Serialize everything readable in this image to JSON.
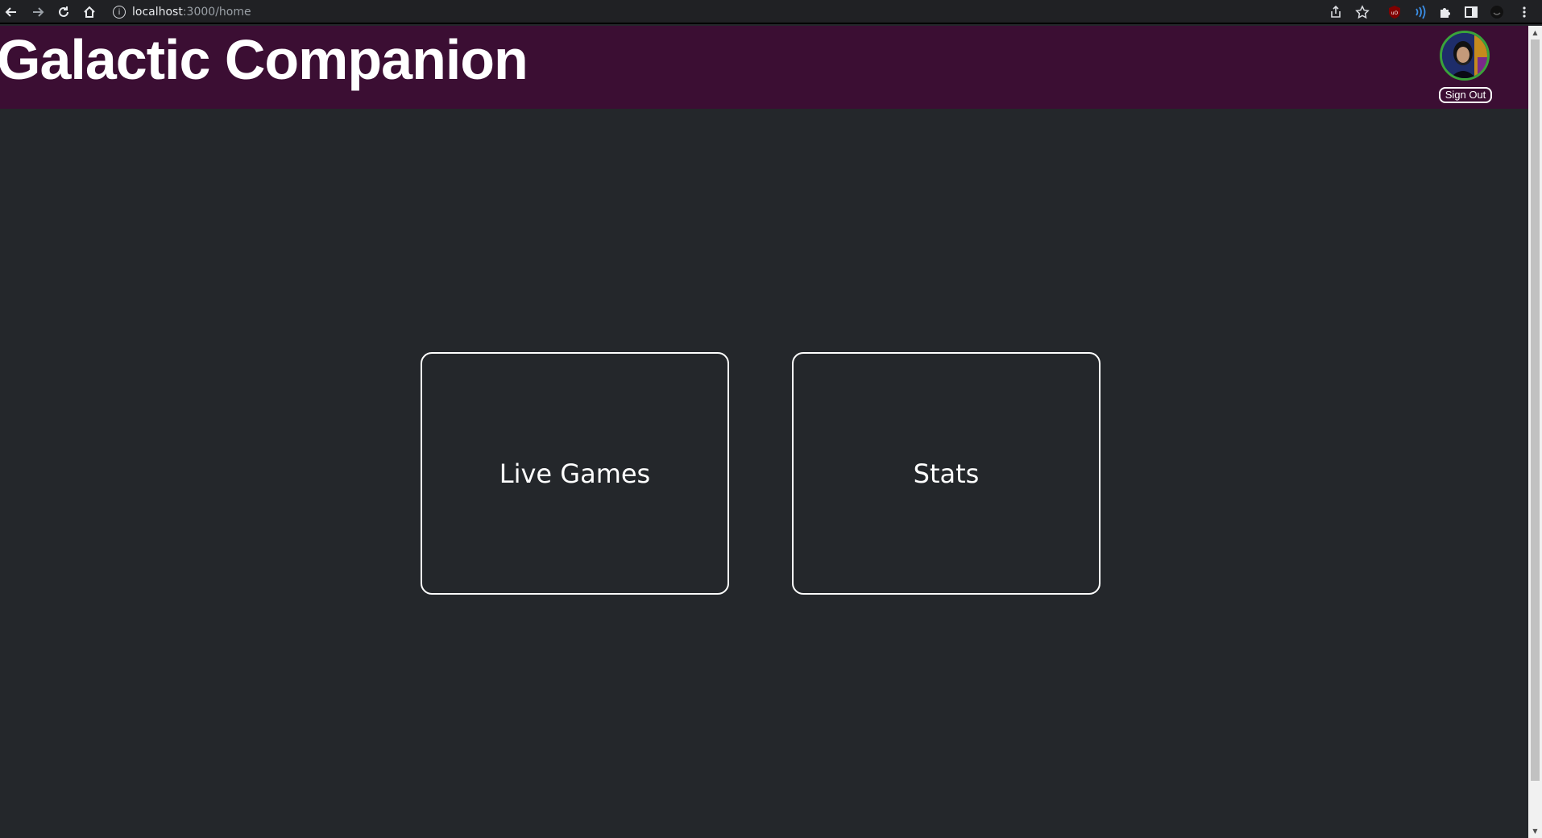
{
  "browser": {
    "url_host": "localhost",
    "url_path": ":3000/home",
    "icons": [
      "back-icon",
      "forward-icon",
      "reload-icon",
      "home-icon",
      "info-icon",
      "share-icon",
      "star-icon",
      "ublock-icon",
      "extension-wave-icon",
      "puzzle-icon",
      "sidebar-icon",
      "profile-icon",
      "menu-icon"
    ]
  },
  "header": {
    "title": "Galactic Companion",
    "background": "#3b0e33",
    "signout_label": "Sign Out"
  },
  "cards": [
    {
      "label": "Live Games"
    },
    {
      "label": "Stats"
    }
  ],
  "colors": {
    "page_background": "#24272b",
    "card_border": "#ffffff",
    "avatar_ring": "#3aa33a"
  }
}
